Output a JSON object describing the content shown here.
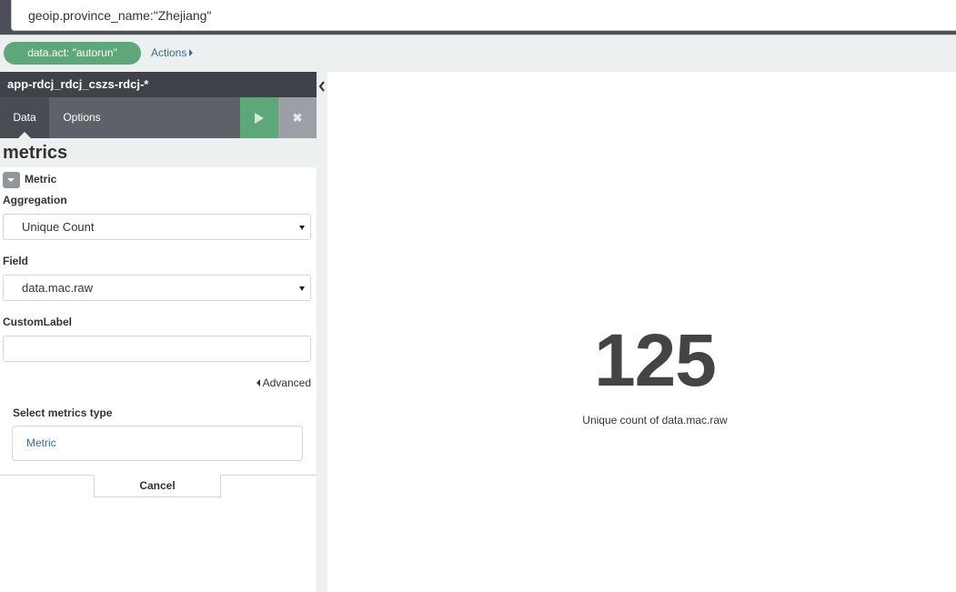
{
  "search": {
    "query": "geoip.province_name:\"Zhejiang\""
  },
  "filterbar": {
    "filter_label": "data.act: \"autorun\"",
    "actions_label": "Actions"
  },
  "sidebar": {
    "index_pattern": "app-rdcj_rdcj_cszs-rdcj-*",
    "tabs": [
      {
        "label": "Data",
        "active": true
      },
      {
        "label": "Options",
        "active": false
      }
    ],
    "close_glyph": "✖",
    "section_title": "metrics",
    "metric": {
      "title": "Metric",
      "aggregation_label": "Aggregation",
      "aggregation_value": "Unique Count",
      "field_label": "Field",
      "field_value": "data.mac.raw",
      "custom_label_label": "CustomLabel",
      "custom_label_value": "",
      "advanced_label": "Advanced"
    },
    "select_metrics_type_label": "Select metrics type",
    "metrics_type_option": "Metric",
    "cancel_label": "Cancel"
  },
  "visualization": {
    "value": "125",
    "caption": "Unique count of data.mac.raw"
  },
  "colors": {
    "accent_green": "#5ea779",
    "dark_header": "#3f4249",
    "tab_bar": "#5e6168",
    "link_blue": "#3a6e8f",
    "panel_bg": "#ecf0f1"
  },
  "icons": {
    "run": "play-icon",
    "close": "close-icon",
    "collapse": "chevron-left-icon",
    "toggle": "caret-down-icon"
  }
}
